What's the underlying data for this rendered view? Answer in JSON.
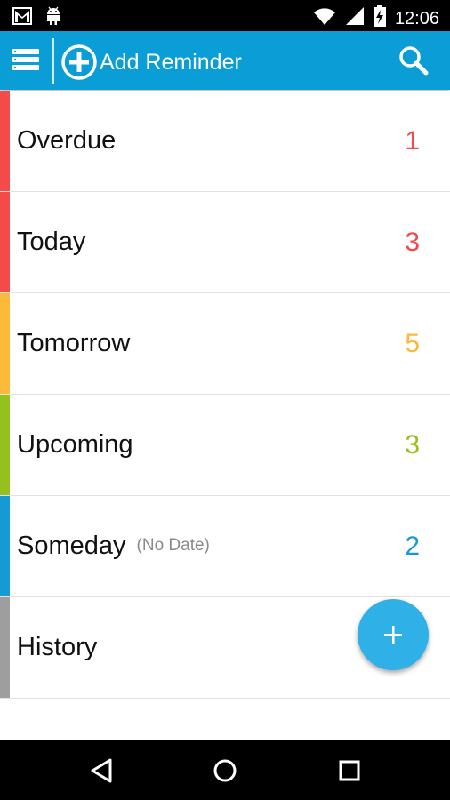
{
  "status_bar": {
    "time": "12:06",
    "left_icons": [
      "gmail-icon",
      "android-icon"
    ],
    "right_icons": [
      "wifi-icon",
      "signal-icon",
      "battery-icon"
    ]
  },
  "action_bar": {
    "add_label": "Add Reminder",
    "background": "#0b9dd6"
  },
  "categories": [
    {
      "label": "Overdue",
      "note": "",
      "count": "1",
      "color": "#f44a4a"
    },
    {
      "label": "Today",
      "note": "",
      "count": "3",
      "color": "#f44a4a"
    },
    {
      "label": "Tomorrow",
      "note": "",
      "count": "5",
      "color": "#fdb93a"
    },
    {
      "label": "Upcoming",
      "note": "",
      "count": "3",
      "color": "#94c11d"
    },
    {
      "label": "Someday",
      "note": "(No Date)",
      "count": "2",
      "color": "#1799d3"
    },
    {
      "label": "History",
      "note": "",
      "count": "",
      "color": "#9e9e9e"
    }
  ],
  "fab": {
    "icon": "plus-icon",
    "color": "#2fb0e6"
  },
  "nav_bar": {
    "icons": [
      "back-icon",
      "home-icon",
      "recents-icon"
    ]
  }
}
